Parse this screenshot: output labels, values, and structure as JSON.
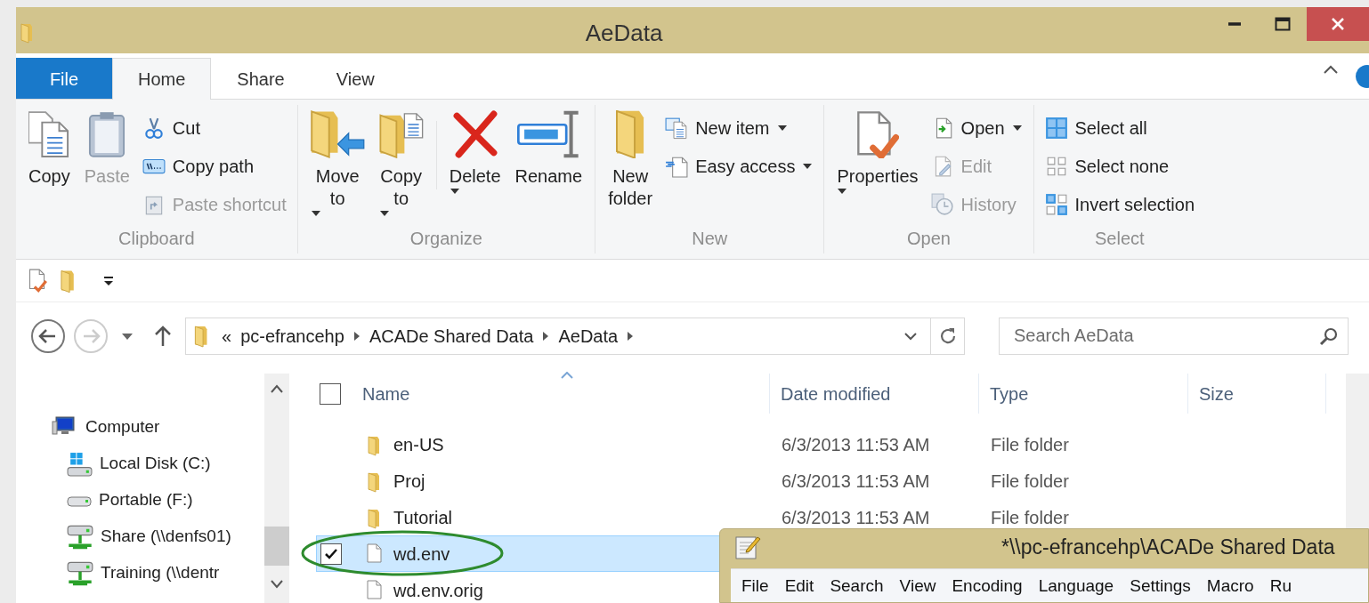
{
  "window": {
    "title": "AeData"
  },
  "ribbon_tabs": [
    {
      "label": "File",
      "kind": "file",
      "selected": false
    },
    {
      "label": "Home",
      "kind": "tab",
      "selected": true
    },
    {
      "label": "Share",
      "kind": "tab",
      "selected": false
    },
    {
      "label": "View",
      "kind": "tab",
      "selected": false
    }
  ],
  "ribbon_groups": [
    {
      "label": "Clipboard",
      "columns": [
        {
          "kind": "large",
          "items": [
            {
              "label": "Copy",
              "disabled": false,
              "dropdown": false
            }
          ]
        },
        {
          "kind": "large",
          "items": [
            {
              "label": "Paste",
              "disabled": true,
              "dropdown": false
            }
          ]
        },
        {
          "kind": "stack",
          "items": [
            {
              "label": "Cut",
              "disabled": false,
              "dropdown": false
            },
            {
              "label": "Copy path",
              "disabled": false,
              "dropdown": false
            },
            {
              "label": "Paste shortcut",
              "disabled": true,
              "dropdown": false
            }
          ]
        }
      ]
    },
    {
      "label": "Organize",
      "columns": [
        {
          "kind": "large",
          "items": [
            {
              "label": "Move to",
              "disabled": false,
              "dropdown": true
            }
          ]
        },
        {
          "kind": "large",
          "items": [
            {
              "label": "Copy to",
              "disabled": false,
              "dropdown": true
            }
          ]
        },
        {
          "kind": "divider"
        },
        {
          "kind": "large",
          "items": [
            {
              "label": "Delete",
              "disabled": false,
              "dropdown": true
            }
          ]
        },
        {
          "kind": "large",
          "items": [
            {
              "label": "Rename",
              "disabled": false,
              "dropdown": false
            }
          ]
        }
      ]
    },
    {
      "label": "New",
      "columns": [
        {
          "kind": "large",
          "items": [
            {
              "label": "New folder",
              "disabled": false,
              "dropdown": false
            }
          ]
        },
        {
          "kind": "stack",
          "items": [
            {
              "label": "New item",
              "disabled": false,
              "dropdown": true
            },
            {
              "label": "Easy access",
              "disabled": false,
              "dropdown": true
            }
          ]
        }
      ]
    },
    {
      "label": "Open",
      "columns": [
        {
          "kind": "large",
          "items": [
            {
              "label": "Properties",
              "disabled": false,
              "dropdown": true
            }
          ]
        },
        {
          "kind": "stack",
          "items": [
            {
              "label": "Open",
              "disabled": false,
              "dropdown": true
            },
            {
              "label": "Edit",
              "disabled": true,
              "dropdown": false
            },
            {
              "label": "History",
              "disabled": true,
              "dropdown": false
            }
          ]
        }
      ]
    },
    {
      "label": "Select",
      "columns": [
        {
          "kind": "stack",
          "items": [
            {
              "label": "Select all",
              "disabled": false,
              "dropdown": false
            },
            {
              "label": "Select none",
              "disabled": false,
              "dropdown": false
            },
            {
              "label": "Invert selection",
              "disabled": false,
              "dropdown": false
            }
          ]
        }
      ]
    }
  ],
  "address": {
    "overflow_marker": "«",
    "path": [
      "pc-efrancehp",
      "ACADe Shared Data",
      "AeData"
    ]
  },
  "search": {
    "placeholder": "Search AeData"
  },
  "sidebar": {
    "items": [
      {
        "label": "Computer",
        "kind": "computer",
        "children": [
          {
            "label": "Local Disk (C:)",
            "kind": "system-drive"
          },
          {
            "label": "Portable (F:)",
            "kind": "drive"
          },
          {
            "label": "Share (\\\\denfs01)",
            "kind": "network-drive"
          },
          {
            "label": "Training (\\\\dentr",
            "kind": "network-drive"
          }
        ]
      }
    ]
  },
  "file_list": {
    "all_selected": false,
    "columns": [
      {
        "label": "Name",
        "sorted": true
      },
      {
        "label": "Date modified",
        "sorted": false
      },
      {
        "label": "Type",
        "sorted": false
      },
      {
        "label": "Size",
        "sorted": false
      }
    ],
    "rows": [
      {
        "name": "en-US",
        "date": "6/3/2013 11:53 AM",
        "type": "File folder",
        "kind": "folder",
        "selected": false
      },
      {
        "name": "Proj",
        "date": "6/3/2013 11:53 AM",
        "type": "File folder",
        "kind": "folder",
        "selected": false
      },
      {
        "name": "Tutorial",
        "date": "6/3/2013 11:53 AM",
        "type": "File folder",
        "kind": "folder",
        "selected": false
      },
      {
        "name": "wd.env",
        "kind": "file",
        "selected": true
      },
      {
        "name": "wd.env.orig",
        "kind": "file",
        "selected": false
      }
    ]
  },
  "notepad": {
    "title": "*\\\\pc-efrancehp\\ACADe Shared Data",
    "menu": [
      "File",
      "Edit",
      "Search",
      "View",
      "Encoding",
      "Language",
      "Settings",
      "Macro",
      "Ru"
    ]
  }
}
